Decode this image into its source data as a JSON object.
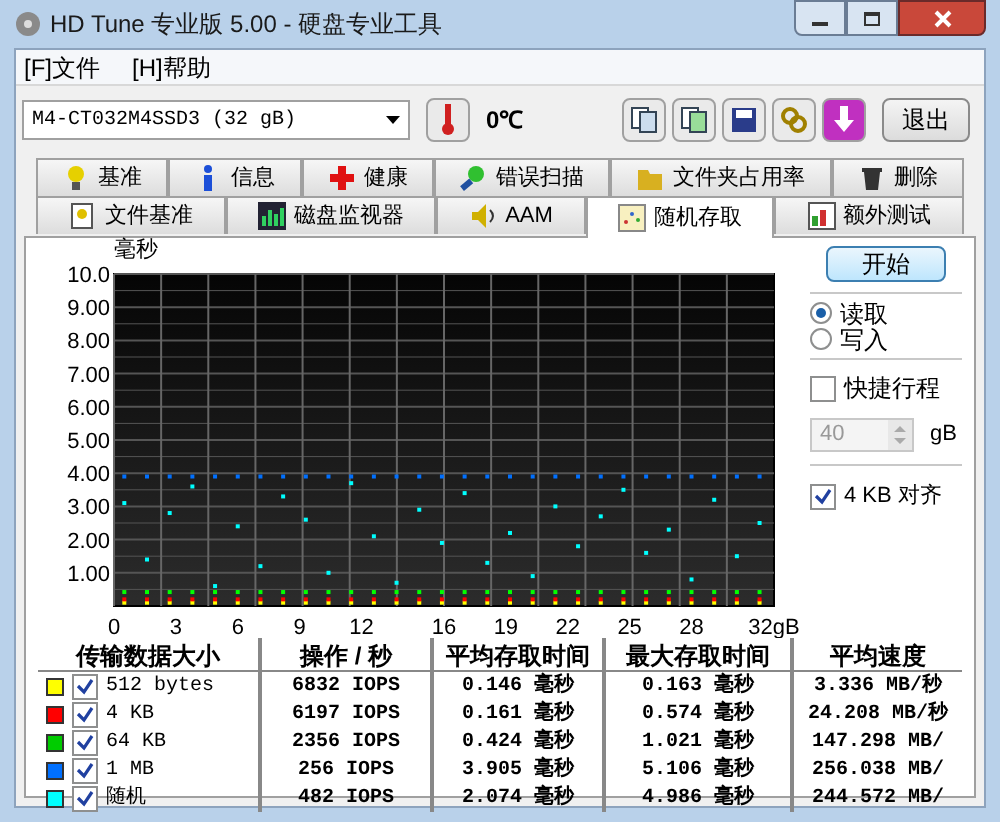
{
  "window": {
    "title": "HD Tune 专业版 5.00 - 硬盘专业工具"
  },
  "menu": [
    "[F]文件",
    "[H]帮助"
  ],
  "toolbar": {
    "drive": "M4-CT032M4SSD3 (32 gB)",
    "temperature": "0℃",
    "exit": "退出"
  },
  "tabs_row1": [
    {
      "label": "基准",
      "selected": false
    },
    {
      "label": "信息",
      "selected": false
    },
    {
      "label": "健康",
      "selected": false
    },
    {
      "label": "错误扫描",
      "selected": false
    },
    {
      "label": "文件夹占用率",
      "selected": false
    },
    {
      "label": "删除",
      "selected": false
    }
  ],
  "tabs_row2": [
    {
      "label": "文件基准",
      "selected": false
    },
    {
      "label": "磁盘监视器",
      "selected": false
    },
    {
      "label": "AAM",
      "selected": false
    },
    {
      "label": "随机存取",
      "selected": true
    },
    {
      "label": "额外测试",
      "selected": false
    }
  ],
  "chart": {
    "chart_data": {
      "type": "scatter",
      "grid": true,
      "ylabel": "毫秒",
      "xlim": [
        0,
        32
      ],
      "ylim": [
        0,
        10
      ],
      "x": [
        0.5,
        1.6,
        2.7,
        3.8,
        4.9,
        6.0,
        7.1,
        8.2,
        9.3,
        10.4,
        11.5,
        12.6,
        13.7,
        14.8,
        15.9,
        17.0,
        18.1,
        19.2,
        20.3,
        21.4,
        22.5,
        23.6,
        24.7,
        25.8,
        26.9,
        28.0,
        29.1,
        30.2,
        31.3
      ],
      "yticks": [
        {
          "value": 1,
          "label": "1.00"
        },
        {
          "value": 2,
          "label": "2.00"
        },
        {
          "value": 3,
          "label": "3.00"
        },
        {
          "value": 4,
          "label": "4.00"
        },
        {
          "value": 5,
          "label": "5.00"
        },
        {
          "value": 6,
          "label": "6.00"
        },
        {
          "value": 7,
          "label": "7.00"
        },
        {
          "value": 8,
          "label": "8.00"
        },
        {
          "value": 9,
          "label": "9.00"
        },
        {
          "value": 10,
          "label": "10.0"
        }
      ],
      "xticks": [
        0,
        3,
        6,
        9,
        12,
        16,
        19,
        22,
        25,
        28,
        {
          "value": 32,
          "label": "32gB"
        }
      ],
      "series": [
        {
          "color": "#ffff00",
          "values": [
            0.1,
            0.1,
            0.1,
            0.1,
            0.1,
            0.1,
            0.1,
            0.1,
            0.1,
            0.1,
            0.1,
            0.1,
            0.1,
            0.1,
            0.1,
            0.1,
            0.1,
            0.1,
            0.1,
            0.1,
            0.1,
            0.1,
            0.1,
            0.1,
            0.1,
            0.1,
            0.1,
            0.1,
            0.1
          ]
        },
        {
          "color": "#ff0000",
          "values": [
            0.2,
            0.2,
            0.2,
            0.2,
            0.2,
            0.2,
            0.2,
            0.2,
            0.2,
            0.2,
            0.2,
            0.2,
            0.2,
            0.2,
            0.2,
            0.2,
            0.2,
            0.2,
            0.2,
            0.2,
            0.2,
            0.2,
            0.2,
            0.2,
            0.2,
            0.2,
            0.2,
            0.2,
            0.2
          ]
        },
        {
          "color": "#00ff00",
          "values": [
            0.42,
            0.42,
            0.42,
            0.42,
            0.42,
            0.42,
            0.42,
            0.42,
            0.42,
            0.42,
            0.42,
            0.42,
            0.42,
            0.42,
            0.42,
            0.42,
            0.42,
            0.42,
            0.42,
            0.42,
            0.42,
            0.42,
            0.42,
            0.42,
            0.42,
            0.42,
            0.42,
            0.42,
            0.42
          ]
        },
        {
          "color": "#0070ff",
          "values": [
            3.9,
            3.9,
            3.9,
            3.9,
            3.9,
            3.9,
            3.9,
            3.9,
            3.9,
            3.9,
            3.9,
            3.9,
            3.9,
            3.9,
            3.9,
            3.9,
            3.9,
            3.9,
            3.9,
            3.9,
            3.9,
            3.9,
            3.9,
            3.9,
            3.9,
            3.9,
            3.9,
            3.9,
            3.9
          ]
        },
        {
          "color": "#00ffff",
          "values": [
            3.1,
            1.4,
            2.8,
            3.6,
            0.6,
            2.4,
            1.2,
            3.3,
            2.6,
            1.0,
            3.7,
            2.1,
            0.7,
            2.9,
            1.9,
            3.4,
            1.3,
            2.2,
            0.9,
            3.0,
            1.8,
            2.7,
            3.5,
            1.6,
            2.3,
            0.8,
            3.2,
            1.5,
            2.5
          ]
        }
      ]
    }
  },
  "controls": {
    "start": "开始",
    "modes": [
      {
        "label": "读取",
        "selected": true
      },
      {
        "label": "写入",
        "selected": false
      }
    ],
    "short_stroke": {
      "label": "快捷行程",
      "checked": false
    },
    "size": {
      "value": "40",
      "unit": "gB",
      "disabled": true
    },
    "align": {
      "label": "4 KB 对齐",
      "checked": true
    }
  },
  "table": {
    "columns": [
      "传输数据大小",
      "操作 / 秒",
      "平均存取时间",
      "最大存取时间",
      "平均速度"
    ],
    "rows": [
      {
        "color": "#ffff00",
        "checked": true,
        "size": "512 bytes",
        "ops": "6832 IOPS",
        "avg": "0.146 毫秒",
        "max": "0.163 毫秒",
        "speed": "3.336 MB/秒"
      },
      {
        "color": "#ff0000",
        "checked": true,
        "size": "4 KB",
        "ops": "6197 IOPS",
        "avg": "0.161 毫秒",
        "max": "0.574 毫秒",
        "speed": "24.208 MB/秒"
      },
      {
        "color": "#00cc00",
        "checked": true,
        "size": "64 KB",
        "ops": "2356 IOPS",
        "avg": "0.424 毫秒",
        "max": "1.021 毫秒",
        "speed": "147.298 MB/"
      },
      {
        "color": "#0070ff",
        "checked": true,
        "size": "1 MB",
        "ops": "256 IOPS",
        "avg": "3.905 毫秒",
        "max": "5.106 毫秒",
        "speed": "256.038 MB/"
      },
      {
        "color": "#00ffff",
        "checked": true,
        "size": "随机",
        "ops": "482 IOPS",
        "avg": "2.074 毫秒",
        "max": "4.986 毫秒",
        "speed": "244.572 MB/"
      }
    ]
  }
}
